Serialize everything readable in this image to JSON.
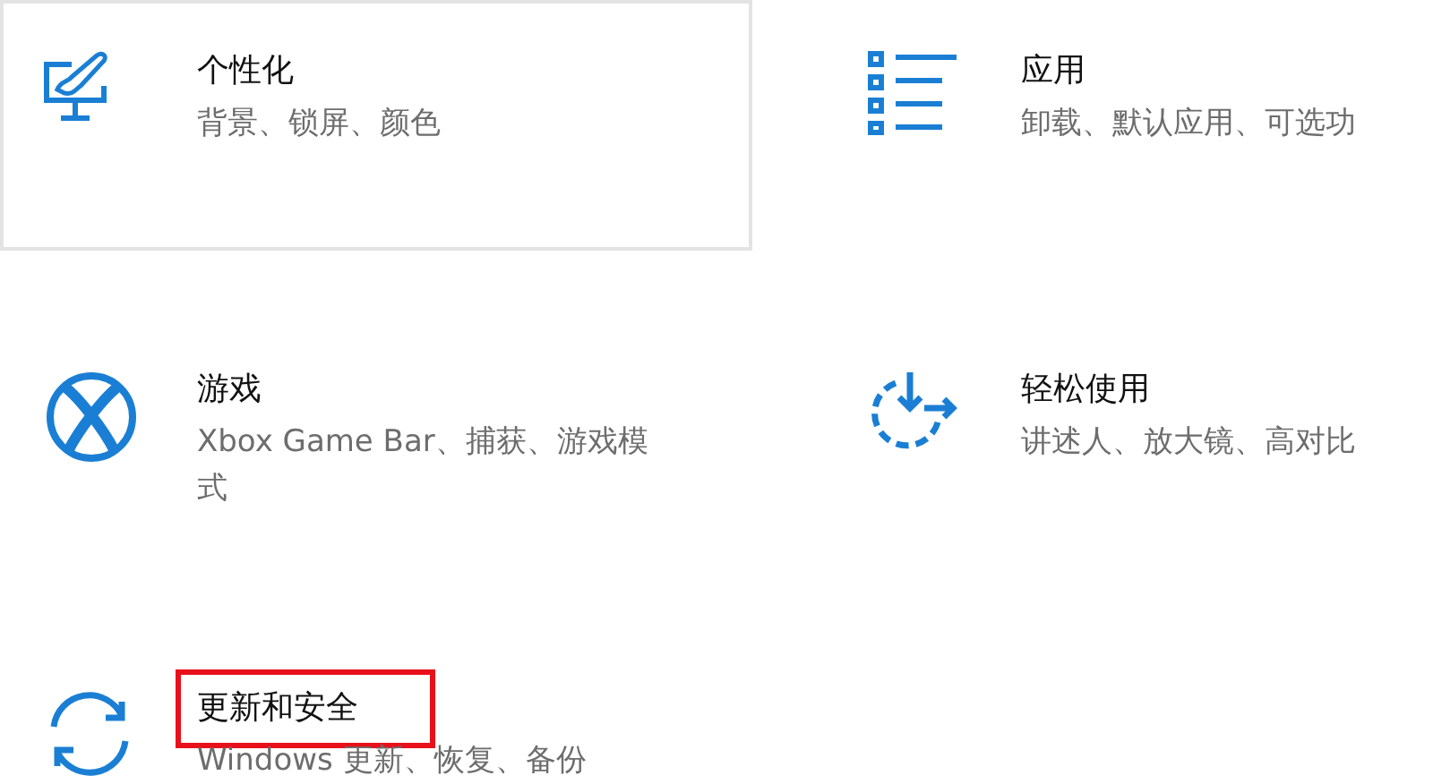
{
  "tiles": [
    {
      "title": "个性化",
      "subtitle": "背景、锁屏、颜色",
      "hovered": true,
      "annotated": false
    },
    {
      "title": "应用",
      "subtitle": "卸载、默认应用、可选功",
      "hovered": false,
      "annotated": false
    },
    {
      "title": "游戏",
      "subtitle": "Xbox Game Bar、捕获、游戏模式",
      "hovered": false,
      "annotated": false
    },
    {
      "title": "轻松使用",
      "subtitle": "讲述人、放大镜、高对比",
      "hovered": false,
      "annotated": false
    },
    {
      "title": "更新和安全",
      "subtitle": "Windows 更新、恢复、备份",
      "hovered": false,
      "annotated": true
    }
  ]
}
